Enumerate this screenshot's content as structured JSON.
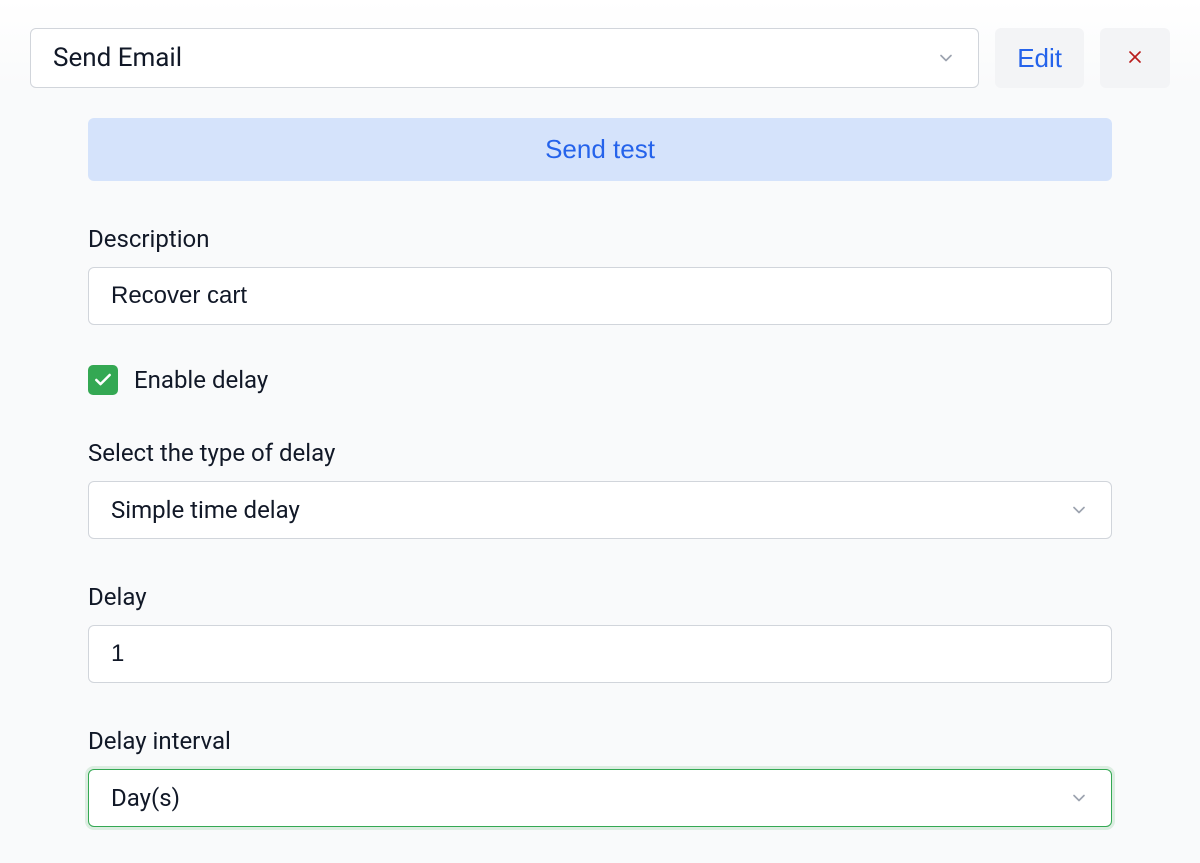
{
  "header": {
    "action_dropdown": {
      "label": "Send Email"
    },
    "edit_button": "Edit"
  },
  "form": {
    "send_test_button": "Send test",
    "description": {
      "label": "Description",
      "value": "Recover cart"
    },
    "enable_delay": {
      "label": "Enable delay",
      "checked": true
    },
    "delay_type": {
      "label": "Select the type of delay",
      "value": "Simple time delay"
    },
    "delay": {
      "label": "Delay",
      "value": "1"
    },
    "delay_interval": {
      "label": "Delay interval",
      "value": "Day(s)"
    }
  }
}
